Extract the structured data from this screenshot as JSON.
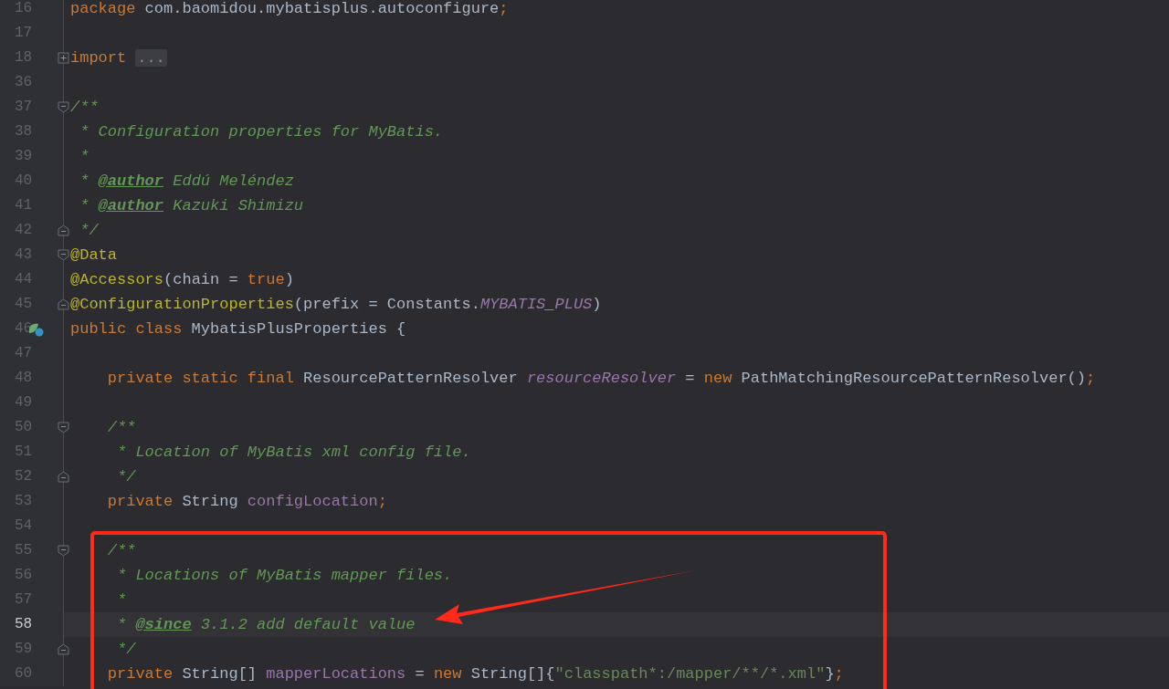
{
  "editor": {
    "lines": [
      {
        "number": "16",
        "current": false,
        "marker": false,
        "tokens": [
          {
            "kind": "kw",
            "text": "package"
          },
          {
            "kind": "plain",
            "text": " com.baomidou.mybatisplus.autoconfigure"
          },
          {
            "kind": "kw",
            "text": ";"
          }
        ]
      },
      {
        "number": "17",
        "current": false,
        "marker": false
      },
      {
        "number": "18",
        "current": false,
        "marker": false,
        "fold_marker": {
          "kind": "collapsed"
        },
        "tokens": [
          {
            "kind": "kw",
            "text": "import"
          },
          {
            "kind": "folded",
            "text": "..."
          }
        ]
      },
      {
        "number": "36",
        "current": false,
        "marker": false
      },
      {
        "number": "37",
        "current": false,
        "marker": false,
        "fold_marker": {
          "kind": "start"
        },
        "tokens": [
          {
            "kind": "doc",
            "text": "/**"
          }
        ]
      },
      {
        "number": "38",
        "current": false,
        "marker": false,
        "tokens": [
          {
            "kind": "doc",
            "text": " * Configuration properties for MyBatis."
          }
        ]
      },
      {
        "number": "39",
        "current": false,
        "marker": false,
        "tokens": [
          {
            "kind": "doc",
            "text": " *"
          }
        ]
      },
      {
        "number": "40",
        "current": false,
        "marker": false,
        "tokens": [
          {
            "kind": "doc",
            "text": " * "
          },
          {
            "kind": "tag",
            "text": "@author"
          },
          {
            "kind": "doc",
            "text": " Eddú Meléndez"
          }
        ]
      },
      {
        "number": "41",
        "current": false,
        "marker": false,
        "tokens": [
          {
            "kind": "doc",
            "text": " * "
          },
          {
            "kind": "tag",
            "text": "@author"
          },
          {
            "kind": "doc",
            "text": " Kazuki Shimizu"
          }
        ]
      },
      {
        "number": "42",
        "current": false,
        "marker": false,
        "fold_marker": {
          "kind": "end"
        },
        "tokens": [
          {
            "kind": "doc",
            "text": " */"
          }
        ]
      },
      {
        "number": "43",
        "current": false,
        "marker": false,
        "fold_marker": {
          "kind": "start"
        },
        "tokens": [
          {
            "kind": "anno",
            "text": "@Data"
          }
        ]
      },
      {
        "number": "44",
        "current": false,
        "marker": false,
        "tokens": [
          {
            "kind": "anno",
            "text": "@Accessors"
          },
          {
            "kind": "plain",
            "text": "(chain = "
          },
          {
            "kind": "kw",
            "text": "true"
          },
          {
            "kind": "plain",
            "text": ")"
          }
        ]
      },
      {
        "number": "45",
        "current": false,
        "marker": false,
        "fold_marker": {
          "kind": "end"
        },
        "tokens": [
          {
            "kind": "anno",
            "text": "@ConfigurationProperties"
          },
          {
            "kind": "plain",
            "text": "(prefix = Constants."
          },
          {
            "kind": "static",
            "text": "MYBATIS_PLUS"
          },
          {
            "kind": "plain",
            "text": ")"
          }
        ]
      },
      {
        "number": "46",
        "current": false,
        "marker": true,
        "tokens": [
          {
            "kind": "kw",
            "text": "public class"
          },
          {
            "kind": "plain",
            "text": " MybatisPlusProperties {"
          }
        ]
      },
      {
        "number": "47",
        "current": false,
        "marker": false
      },
      {
        "number": "48",
        "current": false,
        "marker": false,
        "tokens": [
          {
            "kind": "kw",
            "text": "    private static final"
          },
          {
            "kind": "plain",
            "text": " ResourcePatternResolver "
          },
          {
            "kind": "static",
            "text": "resourceResolver"
          },
          {
            "kind": "plain",
            "text": " = "
          },
          {
            "kind": "kw",
            "text": "new"
          },
          {
            "kind": "plain",
            "text": " PathMatchingResourcePatternResolver()"
          },
          {
            "kind": "kw",
            "text": ";"
          }
        ]
      },
      {
        "number": "49",
        "current": false,
        "marker": false
      },
      {
        "number": "50",
        "current": false,
        "marker": false,
        "fold_marker": {
          "kind": "start"
        },
        "tokens": [
          {
            "kind": "doc",
            "text": "    /**"
          }
        ]
      },
      {
        "number": "51",
        "current": false,
        "marker": false,
        "tokens": [
          {
            "kind": "doc",
            "text": "     * Location of MyBatis xml config file."
          }
        ]
      },
      {
        "number": "52",
        "current": false,
        "marker": false,
        "fold_marker": {
          "kind": "end"
        },
        "tokens": [
          {
            "kind": "doc",
            "text": "     */"
          }
        ]
      },
      {
        "number": "53",
        "current": false,
        "marker": false,
        "tokens": [
          {
            "kind": "kw",
            "text": "    private"
          },
          {
            "kind": "plain",
            "text": " String "
          },
          {
            "kind": "field",
            "text": "configLocation"
          },
          {
            "kind": "kw",
            "text": ";"
          }
        ]
      },
      {
        "number": "54",
        "current": false,
        "marker": false
      },
      {
        "number": "55",
        "current": false,
        "marker": false,
        "fold_marker": {
          "kind": "start"
        },
        "tokens": [
          {
            "kind": "doc",
            "text": "    /**"
          }
        ]
      },
      {
        "number": "56",
        "current": false,
        "marker": false,
        "tokens": [
          {
            "kind": "doc",
            "text": "     * Locations of MyBatis mapper files."
          }
        ]
      },
      {
        "number": "57",
        "current": false,
        "marker": false,
        "tokens": [
          {
            "kind": "doc",
            "text": "     *"
          }
        ]
      },
      {
        "number": "58",
        "current": true,
        "marker": false,
        "tokens": [
          {
            "kind": "doc",
            "text": "     * "
          },
          {
            "kind": "tag",
            "text": "@since"
          },
          {
            "kind": "doc",
            "text": " 3.1.2 add default value"
          }
        ]
      },
      {
        "number": "59",
        "current": false,
        "marker": false,
        "fold_marker": {
          "kind": "end"
        },
        "tokens": [
          {
            "kind": "doc",
            "text": "     */"
          }
        ]
      },
      {
        "number": "60",
        "current": false,
        "marker": false,
        "tokens": [
          {
            "kind": "kw",
            "text": "    private"
          },
          {
            "kind": "plain",
            "text": " String[] "
          },
          {
            "kind": "field",
            "text": "mapperLocations"
          },
          {
            "kind": "plain",
            "text": " = "
          },
          {
            "kind": "kw",
            "text": "new"
          },
          {
            "kind": "plain",
            "text": " String[]{"
          },
          {
            "kind": "str",
            "text": "\"classpath*:/mapper/**/*.xml\""
          },
          {
            "kind": "plain",
            "text": "}"
          },
          {
            "kind": "kw",
            "text": ";"
          }
        ]
      }
    ]
  }
}
